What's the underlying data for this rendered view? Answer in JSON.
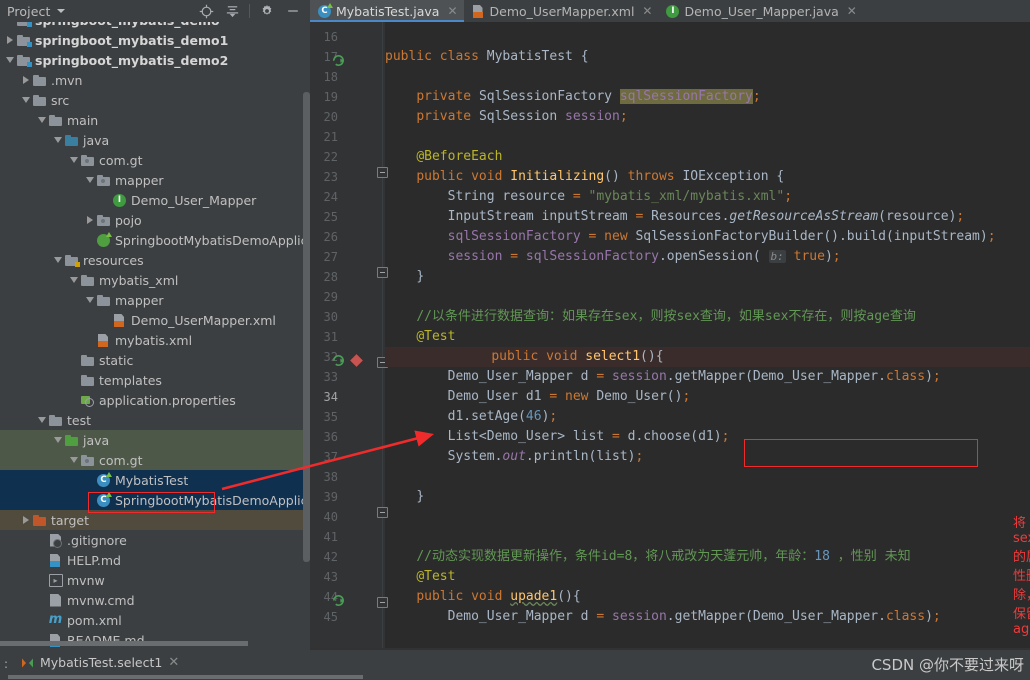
{
  "panel": {
    "title": "Project",
    "icons": [
      "target-icon",
      "collapse-all-icon",
      "gear-icon",
      "minimize-icon"
    ]
  },
  "tree": {
    "rows": [
      {
        "label": "springboot_mybatis_demo",
        "indent": 0,
        "icon": "module-folder-icon",
        "arrow": "none",
        "bold": true,
        "clipped": true
      },
      {
        "label": "springboot_mybatis_demo1",
        "indent": 0,
        "icon": "module-folder-icon",
        "arrow": "right",
        "bold": true
      },
      {
        "label": "springboot_mybatis_demo2",
        "indent": 0,
        "icon": "module-folder-icon",
        "arrow": "down",
        "bold": true
      },
      {
        "label": ".mvn",
        "indent": 1,
        "icon": "folder-icon",
        "arrow": "right"
      },
      {
        "label": "src",
        "indent": 1,
        "icon": "folder-icon",
        "arrow": "down"
      },
      {
        "label": "main",
        "indent": 2,
        "icon": "folder-icon",
        "arrow": "down"
      },
      {
        "label": "java",
        "indent": 3,
        "icon": "source-root-icon",
        "arrow": "down"
      },
      {
        "label": "com.gt",
        "indent": 4,
        "icon": "package-icon",
        "arrow": "down"
      },
      {
        "label": "mapper",
        "indent": 5,
        "icon": "package-icon",
        "arrow": "down"
      },
      {
        "label": "Demo_User_Mapper",
        "indent": 6,
        "icon": "java-interface-icon",
        "arrow": "none"
      },
      {
        "label": "pojo",
        "indent": 5,
        "icon": "package-icon",
        "arrow": "right"
      },
      {
        "label": "SpringbootMybatisDemoApplicat",
        "indent": 5,
        "icon": "spring-class-icon",
        "arrow": "none",
        "clipped": true
      },
      {
        "label": "resources",
        "indent": 3,
        "icon": "resources-root-icon",
        "arrow": "down"
      },
      {
        "label": "mybatis_xml",
        "indent": 4,
        "icon": "folder-icon",
        "arrow": "down"
      },
      {
        "label": "mapper",
        "indent": 5,
        "icon": "folder-icon",
        "arrow": "down"
      },
      {
        "label": "Demo_UserMapper.xml",
        "indent": 6,
        "icon": "xml-file-icon",
        "arrow": "none"
      },
      {
        "label": "mybatis.xml",
        "indent": 5,
        "icon": "xml-file-icon",
        "arrow": "none"
      },
      {
        "label": "static",
        "indent": 4,
        "icon": "folder-icon",
        "arrow": "none"
      },
      {
        "label": "templates",
        "indent": 4,
        "icon": "folder-icon",
        "arrow": "none"
      },
      {
        "label": "application.properties",
        "indent": 4,
        "icon": "properties-file-icon",
        "arrow": "none"
      },
      {
        "label": "test",
        "indent": 2,
        "icon": "folder-icon",
        "arrow": "down"
      },
      {
        "label": "java",
        "indent": 3,
        "icon": "test-source-root-icon",
        "arrow": "down",
        "highlight": "green"
      },
      {
        "label": "com.gt",
        "indent": 4,
        "icon": "package-icon",
        "arrow": "down",
        "highlight": "green"
      },
      {
        "label": "MybatisTest",
        "indent": 5,
        "icon": "java-test-class-icon",
        "arrow": "none",
        "highlight": "blue",
        "boxed": true
      },
      {
        "label": "SpringbootMybatisDemoApplicat",
        "indent": 5,
        "icon": "java-test-class-icon",
        "arrow": "none",
        "highlight": "blue",
        "clipped": true
      },
      {
        "label": "target",
        "indent": 1,
        "icon": "target-folder-icon",
        "arrow": "right",
        "highlight": "brown"
      },
      {
        "label": ".gitignore",
        "indent": 2,
        "icon": "gitignore-file-icon",
        "arrow": "none"
      },
      {
        "label": "HELP.md",
        "indent": 2,
        "icon": "markdown-file-icon",
        "arrow": "none"
      },
      {
        "label": "mvnw",
        "indent": 2,
        "icon": "shell-file-icon",
        "arrow": "none"
      },
      {
        "label": "mvnw.cmd",
        "indent": 2,
        "icon": "text-file-icon",
        "arrow": "none"
      },
      {
        "label": "pom.xml",
        "indent": 2,
        "icon": "maven-file-icon",
        "arrow": "none"
      },
      {
        "label": "README.md",
        "indent": 2,
        "icon": "markdown-file-icon",
        "arrow": "none"
      }
    ]
  },
  "tabs": [
    {
      "label": "MybatisTest.java",
      "icon": "java-test-class-icon",
      "active": true
    },
    {
      "label": "Demo_UserMapper.xml",
      "icon": "xml-file-icon",
      "active": false
    },
    {
      "label": "Demo_User_Mapper.java",
      "icon": "java-interface-icon",
      "active": false
    }
  ],
  "editor": {
    "first_line": 16,
    "last_line": 45,
    "caret_line": 34,
    "current_line_highlight": 32,
    "code": [
      {
        "n": 16,
        "text": ""
      },
      {
        "n": 17,
        "text": "public class MybatisTest {"
      },
      {
        "n": 18,
        "text": ""
      },
      {
        "n": 19,
        "text": "    private SqlSessionFactory sqlSessionFactory;"
      },
      {
        "n": 20,
        "text": "    private SqlSession session;"
      },
      {
        "n": 21,
        "text": ""
      },
      {
        "n": 22,
        "text": "    @BeforeEach"
      },
      {
        "n": 23,
        "text": "    public void Initializing() throws IOException {"
      },
      {
        "n": 24,
        "text": "        String resource = \"mybatis_xml/mybatis.xml\";"
      },
      {
        "n": 25,
        "text": "        InputStream inputStream = Resources.getResourceAsStream(resource);"
      },
      {
        "n": 26,
        "text": "        sqlSessionFactory = new SqlSessionFactoryBuilder().build(inputStream);"
      },
      {
        "n": 27,
        "text": "        session = sqlSessionFactory.openSession( b: true);"
      },
      {
        "n": 28,
        "text": "    }"
      },
      {
        "n": 29,
        "text": ""
      },
      {
        "n": 30,
        "text": "    //以条件进行数据查询：如果存在sex，则按sex查询，如果sex不存在，则按age查询"
      },
      {
        "n": 31,
        "text": "    @Test"
      },
      {
        "n": 32,
        "text": "    public void select1(){"
      },
      {
        "n": 33,
        "text": "        Demo_User_Mapper d = session.getMapper(Demo_User_Mapper.class);"
      },
      {
        "n": 34,
        "text": "        Demo_User d1 = new Demo_User();"
      },
      {
        "n": 35,
        "text": "        d1.setAge(46);"
      },
      {
        "n": 36,
        "text": "        List<Demo_User> list = d.choose(d1);"
      },
      {
        "n": 37,
        "text": "        System.out.println(list);"
      },
      {
        "n": 38,
        "text": ""
      },
      {
        "n": 39,
        "text": "    }"
      },
      {
        "n": 40,
        "text": ""
      },
      {
        "n": 41,
        "text": ""
      },
      {
        "n": 42,
        "text": "    //动态实现数据更新操作，条件id=8，将八戒改为天蓬元帅，年龄：18 ，性别 未知"
      },
      {
        "n": 43,
        "text": "    @Test"
      },
      {
        "n": 44,
        "text": "    public void upade1(){"
      },
      {
        "n": 45,
        "text": "        Demo_User_Mapper d = session.getMapper(Demo_User_Mapper.class);"
      }
    ]
  },
  "annotations": {
    "note_text": "将sex的属性删除，保留age",
    "note_color": "#ef3b3b",
    "box_color": "#ef2b2b",
    "arrow_color": "#ef2b2b"
  },
  "bottom": {
    "run_label": ":",
    "run_tab": "MybatisTest.select1",
    "watermark": "CSDN @你不要过来呀"
  },
  "colors": {
    "editor_bg": "#2b2b2b",
    "gutter_bg": "#313335",
    "panel_bg": "#3c3f41",
    "tab_active_bg": "#4e5254",
    "tab_underline": "#4a88c7",
    "selection_blue": "#103050",
    "source_green": "#4e5849",
    "current_line": "#3a2c2a"
  }
}
